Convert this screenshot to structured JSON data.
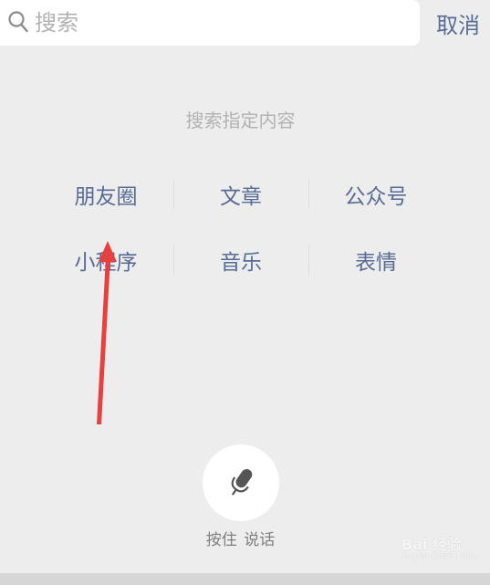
{
  "search": {
    "placeholder": "搜索",
    "cancel_label": "取消"
  },
  "hint": "搜索指定内容",
  "categories": [
    [
      "朋友圈",
      "文章",
      "公众号"
    ],
    [
      "小程序",
      "音乐",
      "表情"
    ]
  ],
  "voice": {
    "label": "按住 说话",
    "icon": "microphone-icon"
  },
  "watermark": {
    "brand": "Bai 经验",
    "url": "jingyan.baidu.com"
  },
  "colors": {
    "background": "#ededed",
    "link": "#576b95",
    "hint": "#b2b2b2",
    "annotation_arrow": "#e8403f"
  }
}
